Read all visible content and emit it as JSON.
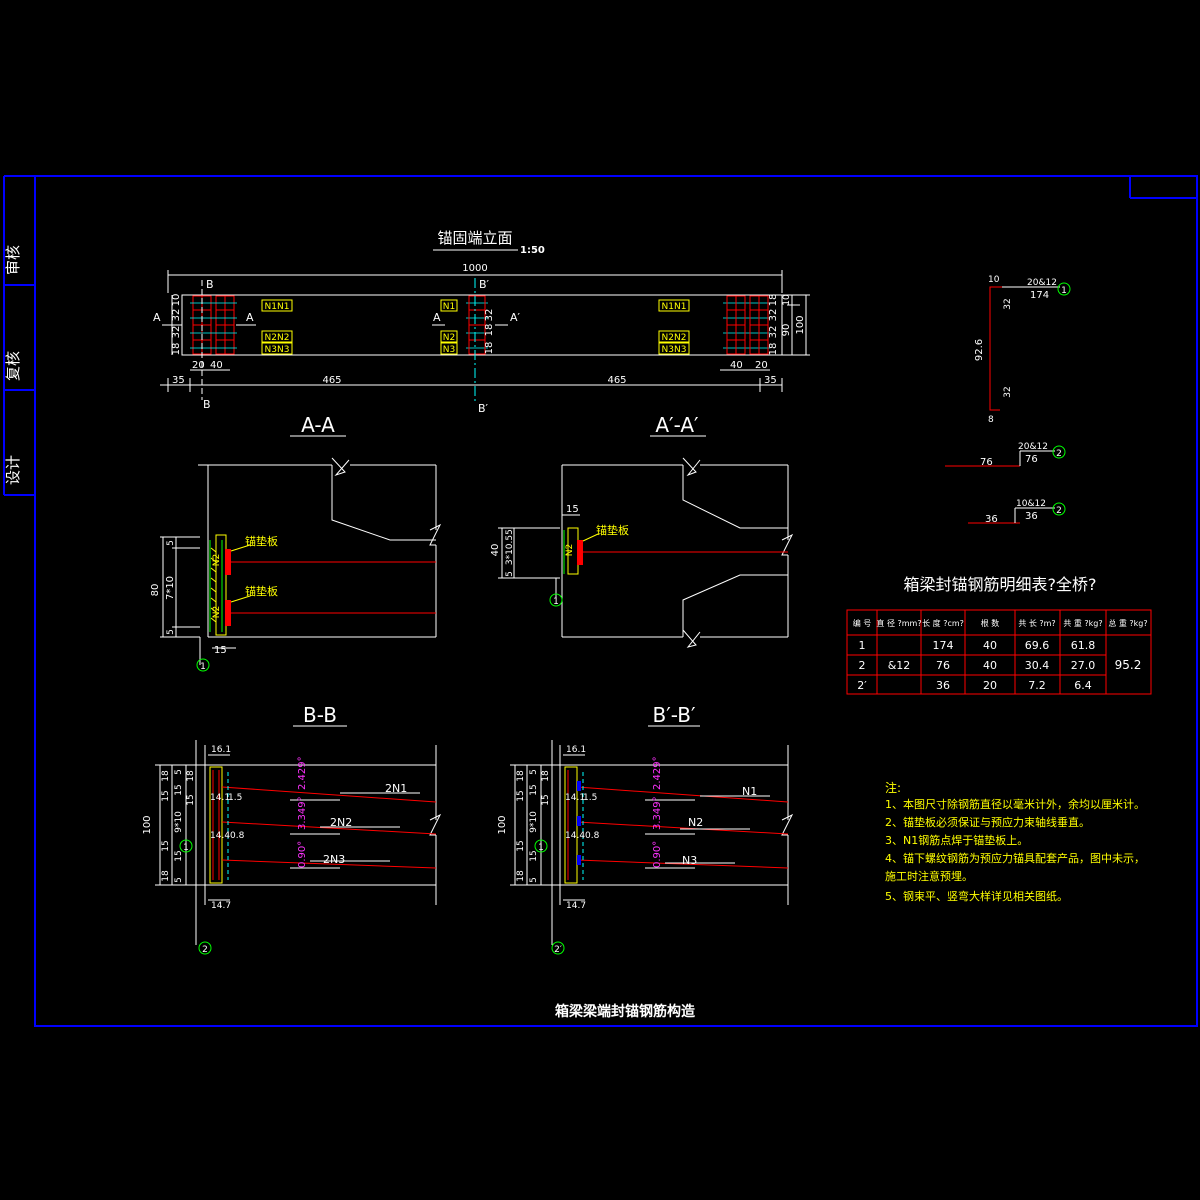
{
  "side_labels": [
    "审核",
    "复核",
    "设计"
  ],
  "elevation": {
    "title": "锚固端立面",
    "scale": "1:50",
    "dims": {
      "total": "1000",
      "left_end": "35",
      "left_span": "465",
      "right_span": "465",
      "right_end": "35",
      "left_20": "20",
      "left_40": "40",
      "right_40": "40",
      "right_20": "20",
      "height_90": "90",
      "height_100": "100",
      "v_10": "10",
      "v_32": "32",
      "v_18": "18"
    },
    "labels": {
      "B_top_left": "B",
      "B_top_mid": "B′",
      "B_bot_left": "B",
      "B_bot_mid": "B′",
      "A_left1": "A",
      "A_left2": "A",
      "A_mid1": "A",
      "A_mid2": "A′",
      "n_left_top": "N1N1",
      "n_left_bot": "N2N2",
      "n_left_bot2": "N3N3",
      "n_mid_top": "N1",
      "n_mid_bot": "N2",
      "n_mid_bot2": "N3",
      "n_right_top": "N1N1",
      "n_right_bot": "N2N2",
      "n_right_bot2": "N3N3"
    }
  },
  "sections": {
    "aa": {
      "title": "A-A",
      "plate1": "锚垫板",
      "plate2": "锚垫板",
      "dims": {
        "h80": "80",
        "d5a": "5",
        "d7x10": "7*10",
        "d5b": "5",
        "d15": "15"
      },
      "n1": "N2",
      "n2": "N2",
      "circle": "1"
    },
    "aprime": {
      "title": "A′-A′",
      "plate": "锚垫板",
      "dims": {
        "h40": "40",
        "d5a": "5",
        "d3x10": "3*10.5",
        "d5b": "5",
        "d15": "15"
      },
      "n": "N2",
      "circle": "1"
    },
    "bb": {
      "title": "B-B",
      "dims": {
        "h100": "100",
        "top": "16.1",
        "d14_1": "14.1",
        "d1_5": "1.5",
        "d14_4": "14.4",
        "d0_8": "0.8",
        "bottom": "14.7",
        "v18a": "18",
        "v5a": "5",
        "v15a": "15",
        "v15b": "15",
        "v15c": "15",
        "v9x10": "9*10",
        "v18b": "18",
        "v5b": "5",
        "v15d": "15"
      },
      "angles": [
        "2.429°",
        "3.349°",
        "0.90°"
      ],
      "bars": [
        "2N1",
        "2N2",
        "2N3"
      ],
      "circle1": "1",
      "circle2": "2"
    },
    "bprime": {
      "title": "B′-B′",
      "dims": {
        "h100": "100",
        "top": "16.1",
        "d14_1": "14.1",
        "d1_5": "1.5",
        "d14_4": "14.4",
        "d0_8": "0.8",
        "bottom": "14.7",
        "v18a": "18",
        "v5a": "5",
        "v15a": "15",
        "v15b": "15",
        "v15c": "15",
        "v9x10": "9*10",
        "v18b": "18",
        "v5b": "5",
        "v15d": "15"
      },
      "angles": [
        "2.429°",
        "3.349°",
        "0.90°"
      ],
      "bars": [
        "N1",
        "N2",
        "N3"
      ],
      "circle1": "1",
      "circle2": "2′"
    }
  },
  "bar_shapes": {
    "b1": {
      "spec": "20&12",
      "len": "174",
      "circle": "1",
      "top": "10",
      "d32a": "32",
      "mid": "92.6",
      "d32b": "32",
      "bot": "8"
    },
    "b2": {
      "spec": "20&12",
      "len": "76",
      "seg": "76",
      "circle": "2"
    },
    "b3": {
      "spec": "10&12",
      "len": "36",
      "seg": "36",
      "circle": "2"
    }
  },
  "table": {
    "title": "箱梁封锚钢筋明细表?全桥?",
    "headers": [
      "编 号",
      "直 径\n?mm?",
      "长 度\n?cm?",
      "根 数",
      "共 长\n?m?",
      "共 重\n?kg?",
      "总 重\n?kg?"
    ],
    "rows": [
      [
        "1",
        "",
        "174",
        "40",
        "69.6",
        "61.8"
      ],
      [
        "2",
        "&12",
        "76",
        "40",
        "30.4",
        "27.0"
      ],
      [
        "2′",
        "",
        "36",
        "20",
        "7.2",
        "6.4"
      ]
    ],
    "diameter": "&12",
    "total": "95.2"
  },
  "notes": {
    "title": "注:",
    "items": [
      "1、本图尺寸除钢筋直径以毫米计外，余均以厘米计。",
      "2、锚垫板必须保证与预应力束轴线垂直。",
      "3、N1钢筋点焊于锚垫板上。",
      "4、锚下螺纹钢筋为预应力锚具配套产品，图中未示，",
      "   施工时注意预埋。",
      "5、钢束平、竖弯大样详见相关图纸。"
    ]
  },
  "drawing_title": "箱梁梁端封锚钢筋构造",
  "colors": {
    "frame": "#0000ff",
    "line": "#ffffff",
    "text": "#ffffff",
    "note": "#ffff00",
    "bar": "#ff0000",
    "hatch": "#00ff00",
    "anno": "#ff33ff",
    "table": "#ff0000"
  }
}
